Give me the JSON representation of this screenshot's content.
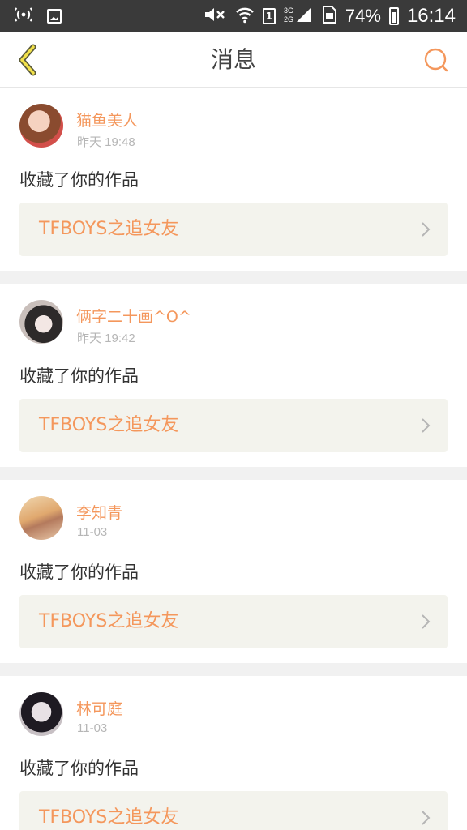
{
  "status_bar": {
    "battery": "74%",
    "time": "16:14",
    "sim_slot": "1",
    "network_label": "3G 2G"
  },
  "header": {
    "title": "消息",
    "accent_color": "#f4975c"
  },
  "messages": [
    {
      "name": "猫鱼美人",
      "time": "昨天 19:48",
      "action": "收藏了你的作品",
      "work_title": "TFBOYS之追女友"
    },
    {
      "name": "俩字二十画^O^",
      "time": "昨天 19:42",
      "action": "收藏了你的作品",
      "work_title": "TFBOYS之追女友"
    },
    {
      "name": "李知青",
      "time": "11-03",
      "action": "收藏了你的作品",
      "work_title": "TFBOYS之追女友"
    },
    {
      "name": "林可庭",
      "time": "11-03",
      "action": "收藏了你的作品",
      "work_title": "TFBOYS之追女友"
    }
  ]
}
